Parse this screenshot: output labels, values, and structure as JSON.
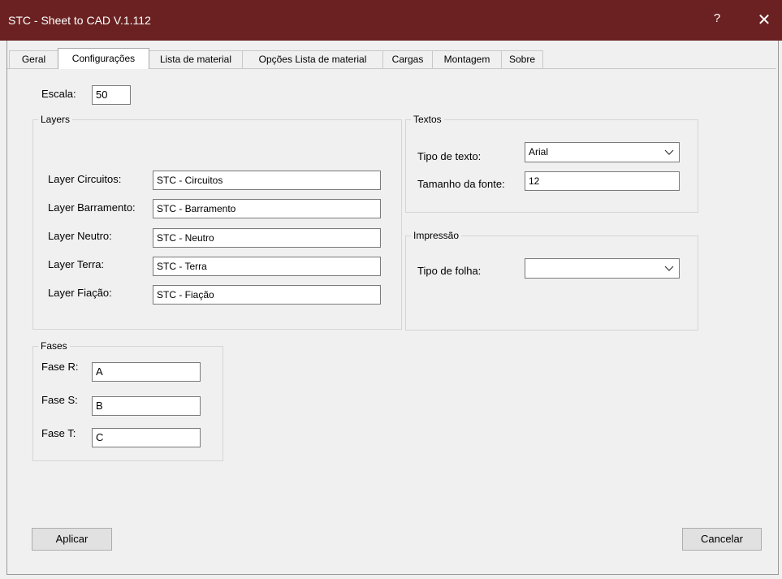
{
  "window": {
    "title": "STC - Sheet to CAD V.1.112",
    "help": "?",
    "close": "✕"
  },
  "tabs": [
    "Geral",
    "Configurações",
    "Lista de material",
    "Opções Lista de material",
    "Cargas",
    "Montagem",
    "Sobre"
  ],
  "active_tab": "Configurações",
  "escala": {
    "label": "Escala:",
    "value": "50"
  },
  "layers": {
    "title": "Layers",
    "items": [
      {
        "label": "Layer Circuitos:",
        "value": "STC - Circuitos"
      },
      {
        "label": "Layer Barramento:",
        "value": "STC - Barramento"
      },
      {
        "label": "Layer Neutro:",
        "value": "STC - Neutro"
      },
      {
        "label": "Layer Terra:",
        "value": "STC - Terra"
      },
      {
        "label": "Layer Fiação:",
        "value": "STC - Fiação"
      }
    ]
  },
  "textos": {
    "title": "Textos",
    "tipo_label": "Tipo de texto:",
    "tipo_value": "Arial",
    "tamanho_label": "Tamanho da fonte:",
    "tamanho_value": "12"
  },
  "impressao": {
    "title": "Impressão",
    "folha_label": "Tipo de folha:",
    "folha_value": ""
  },
  "fases": {
    "title": "Fases",
    "items": [
      {
        "label": "Fase R:",
        "value": "A"
      },
      {
        "label": "Fase S:",
        "value": "B"
      },
      {
        "label": "Fase T:",
        "value": "C"
      }
    ]
  },
  "buttons": {
    "apply": "Aplicar",
    "cancel": "Cancelar"
  },
  "colors": {
    "titlebar": "#6b2121",
    "window_bg": "#f0f0f0"
  }
}
